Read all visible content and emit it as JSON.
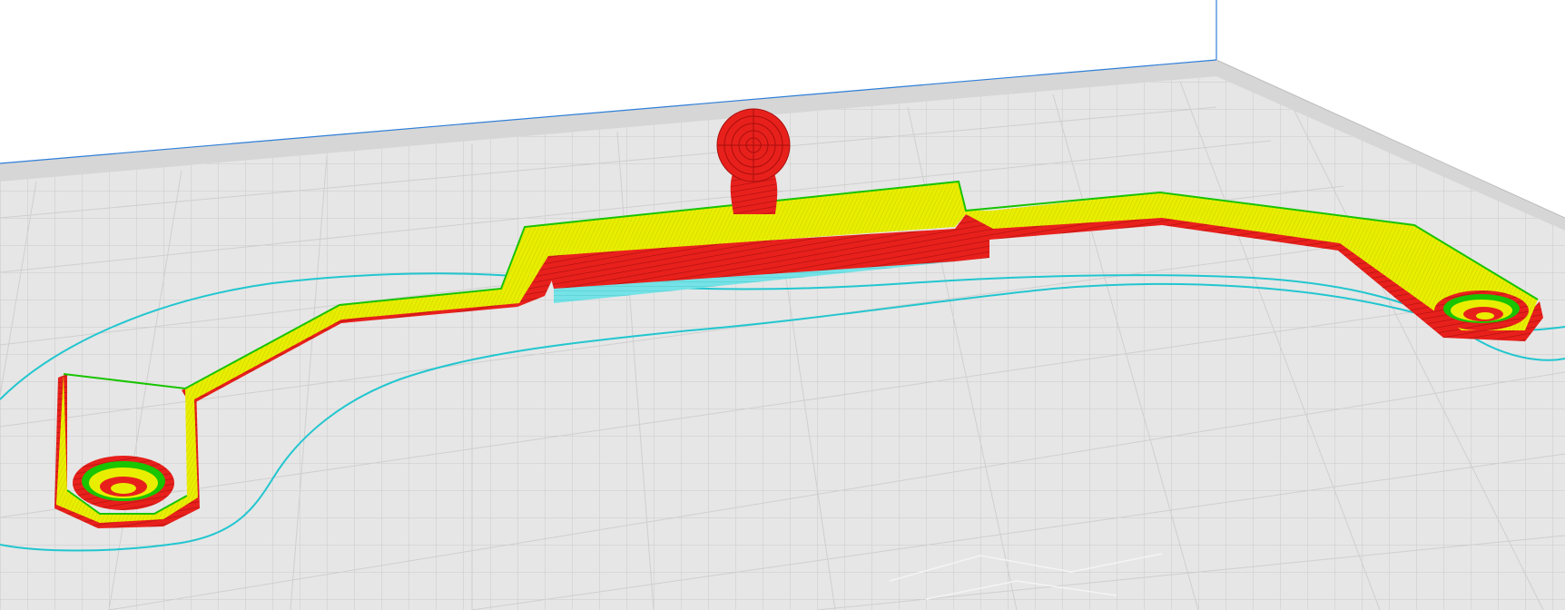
{
  "app": {
    "view": "layer-preview",
    "description_visible_text": ""
  },
  "scene": {
    "background_color": "#ffffff",
    "build_plate": {
      "fill_color": "#e6e6e6",
      "grid_color": "#c8c8c8",
      "border_color": "#d0d0d0",
      "volume_edge_color": "#2f7fd8"
    },
    "print_colors": {
      "wall_outer": "#e8201c",
      "wall_outer_dark": "#c41512",
      "top_skin": "#e6ec00",
      "inner_wall": "#19c400",
      "support": "#74e2e6",
      "skirt": "#22c6cf"
    },
    "objects": [
      {
        "name": "bracket-arm",
        "icon": "model-object"
      },
      {
        "name": "ball-knob",
        "icon": "model-object"
      },
      {
        "name": "support-block",
        "icon": "support-structure"
      },
      {
        "name": "skirt-outline",
        "icon": "skirt-line"
      }
    ]
  }
}
